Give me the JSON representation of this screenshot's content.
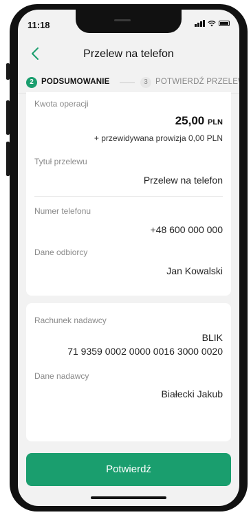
{
  "status_bar": {
    "time": "11:18"
  },
  "header": {
    "title": "Przelew na telefon"
  },
  "steps": {
    "active": {
      "number": "2",
      "label": "PODSUMOWANIE"
    },
    "next": {
      "number": "3",
      "label": "POTWIERDŹ PRZELEW"
    }
  },
  "summary": {
    "amount_label": "Kwota operacji",
    "amount_value": "25,00",
    "amount_currency": "PLN",
    "fee_note": "+ przewidywana prowizja 0,00 PLN",
    "title_label": "Tytuł przelewu",
    "title_value": "Przelew na telefon",
    "phone_label": "Numer telefonu",
    "phone_value": "+48 600 000 000",
    "recipient_label": "Dane odbiorcy",
    "recipient_value": "Jan Kowalski"
  },
  "sender": {
    "account_label": "Rachunek nadawcy",
    "account_name": "BLIK",
    "account_number": "71 9359 0002 0000 0016 3000 0020",
    "sender_label": "Dane nadawcy",
    "sender_value": "Białecki Jakub"
  },
  "confirm_button": "Potwierdź",
  "colors": {
    "accent": "#1a9e6e",
    "background": "#f2f2f2"
  },
  "icons": {
    "back": "chevron-left-icon"
  }
}
